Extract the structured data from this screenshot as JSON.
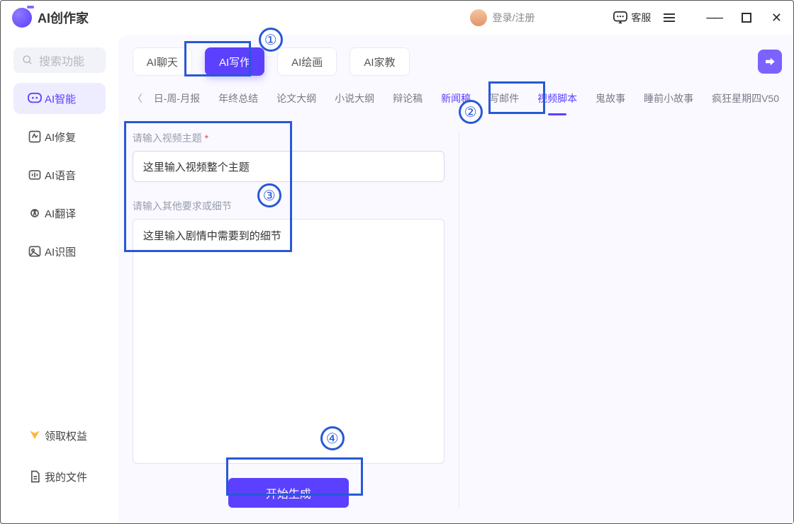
{
  "app": {
    "title": "AI创作家"
  },
  "titlebar": {
    "login": "登录/注册",
    "service": "客服"
  },
  "sidebar": {
    "search_placeholder": "搜索功能",
    "items": [
      {
        "label": "AI智能"
      },
      {
        "label": "AI修复"
      },
      {
        "label": "AI语音"
      },
      {
        "label": "AI翻译"
      },
      {
        "label": "AI识图"
      }
    ],
    "bottom": [
      {
        "label": "领取权益"
      },
      {
        "label": "我的文件"
      }
    ]
  },
  "tabs": [
    {
      "label": "AI聊天"
    },
    {
      "label": "AI写作"
    },
    {
      "label": "AI绘画"
    },
    {
      "label": "AI家教"
    }
  ],
  "subtabs": {
    "items": [
      "日-周-月报",
      "年终总结",
      "论文大纲",
      "小说大纲",
      "辩论稿",
      "新闻稿",
      "写邮件",
      "视频脚本",
      "鬼故事",
      "睡前小故事",
      "疯狂星期四V50"
    ]
  },
  "form": {
    "topic_label": "请输入视频主题",
    "topic_value": "这里输入视频整个主题",
    "detail_label": "请输入其他要求或细节",
    "detail_value": "这里输入剧情中需要到的细节",
    "generate": "开始生成"
  },
  "annotations": [
    "①",
    "②",
    "③",
    "④"
  ]
}
